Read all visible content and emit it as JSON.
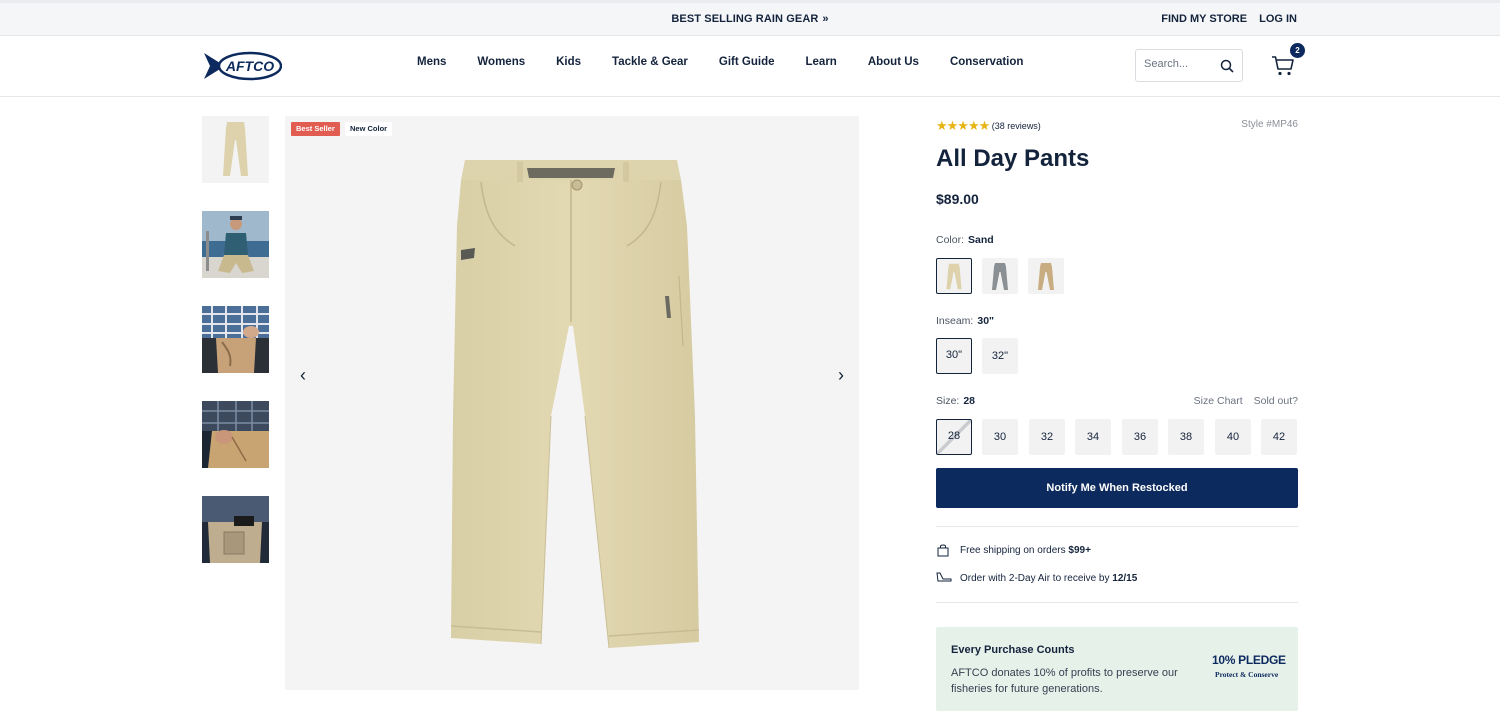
{
  "promo": {
    "text": "BEST SELLING RAIN GEAR",
    "chevron": "»"
  },
  "utility": {
    "find_store": "FIND MY STORE",
    "login": "LOG IN"
  },
  "logo": {
    "text": "AFTCO"
  },
  "nav": [
    "Mens",
    "Womens",
    "Kids",
    "Tackle & Gear",
    "Gift Guide",
    "Learn",
    "About Us",
    "Conservation"
  ],
  "search": {
    "placeholder": "Search..."
  },
  "cart": {
    "count": "2"
  },
  "gallery": {
    "thumbnails": [
      "pants-product",
      "model-on-boat",
      "plaid-shirt-pocket",
      "hand-in-pocket",
      "cargo-pocket-detail"
    ],
    "badges": {
      "best_seller": "Best Seller",
      "new_color": "New Color"
    },
    "prev_arrow": "‹",
    "next_arrow": "›"
  },
  "product": {
    "stars": "★★★★★",
    "rating": 5,
    "reviews": "(38 reviews)",
    "style": "Style #MP46",
    "title": "All Day Pants",
    "price": "$89.00"
  },
  "color": {
    "label": "Color:",
    "selected": "Sand",
    "swatches": [
      "Sand",
      "Gray",
      "Khaki"
    ]
  },
  "inseam": {
    "label": "Inseam:",
    "selected": "30\"",
    "options": [
      "30\"",
      "32\""
    ]
  },
  "size": {
    "label": "Size:",
    "selected": "28",
    "options": [
      "28",
      "30",
      "32",
      "34",
      "36",
      "38",
      "40",
      "42"
    ],
    "size_chart": "Size Chart",
    "sold_out": "Sold out?"
  },
  "cta": {
    "notify": "Notify Me When Restocked"
  },
  "shipping": {
    "free_text": "Free shipping on orders ",
    "free_amount": "$99+",
    "air_text": "Order with 2-Day Air to receive by ",
    "air_date": "12/15"
  },
  "pledge": {
    "title": "Every Purchase Counts",
    "desc": "AFTCO donates 10% of profits to preserve our fisheries for future generations.",
    "logo_main": "10% PLEDGE",
    "logo_sub": "Protect & Conserve"
  },
  "colors": {
    "navy": "#0d2a5e",
    "sand": "#ddd2ac",
    "sale_red": "#e15d52",
    "pledge_bg": "#e6f1ea",
    "star": "#e7b416"
  }
}
